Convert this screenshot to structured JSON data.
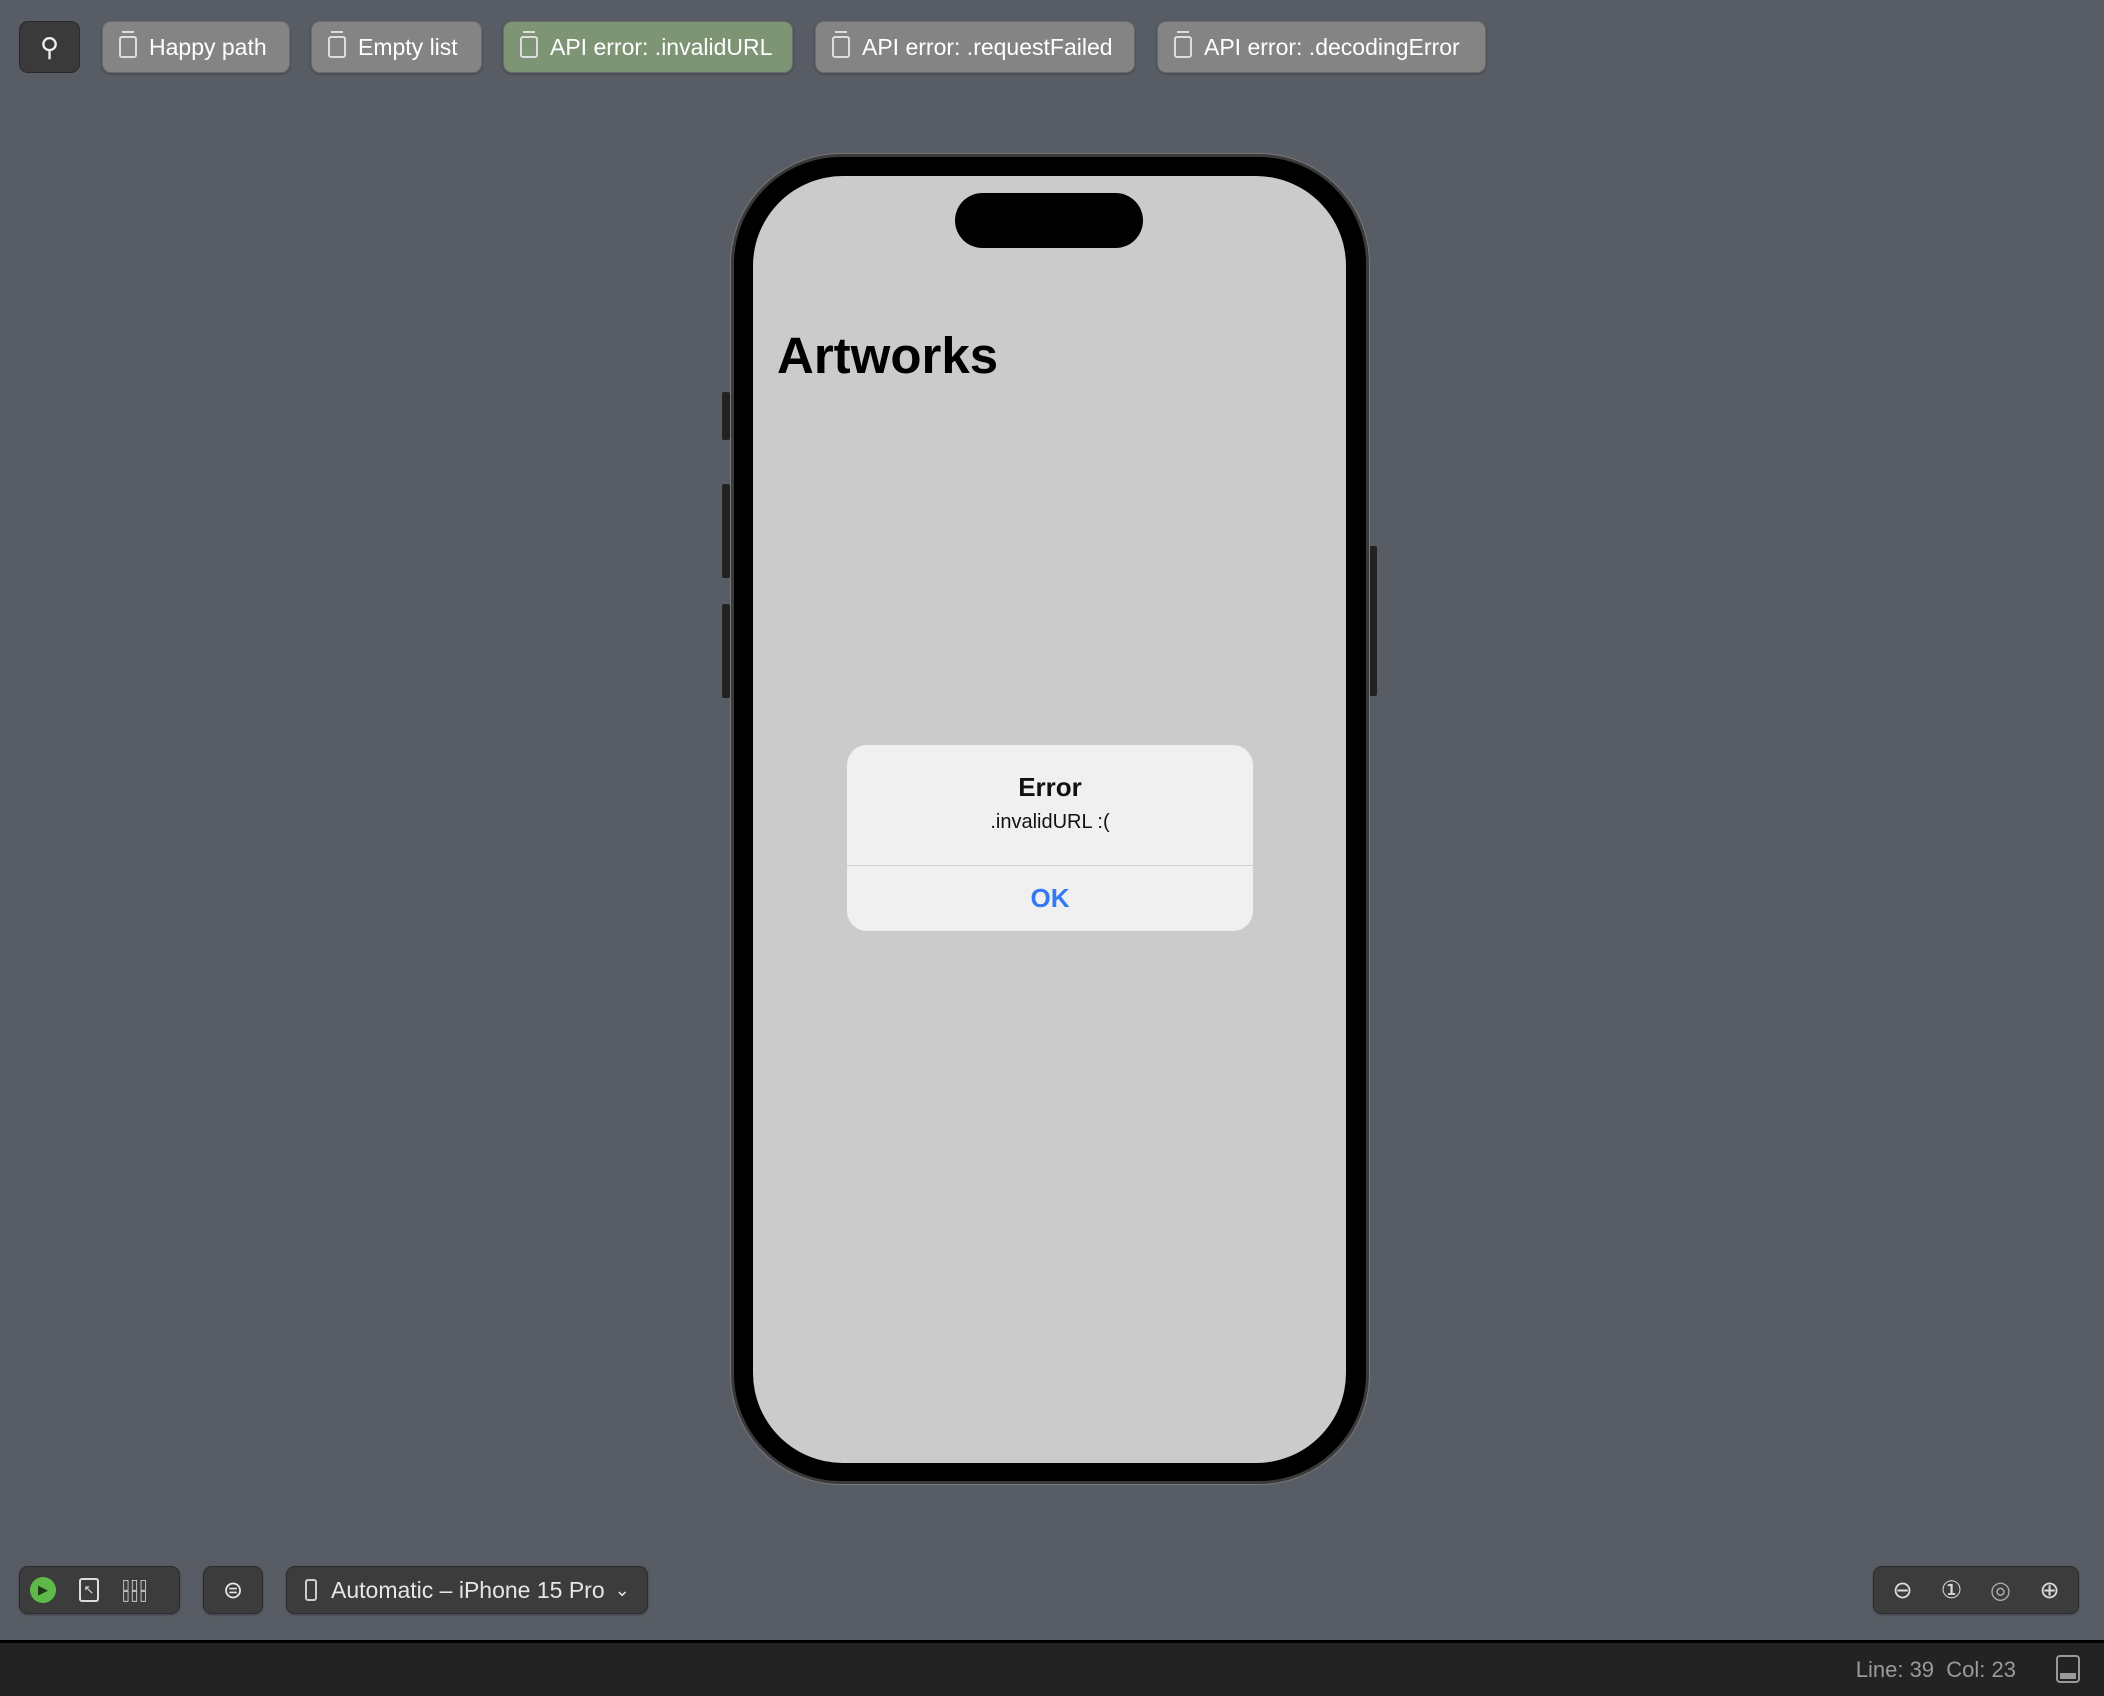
{
  "top_bar": {
    "pin_icon": "pin-icon",
    "previews": [
      {
        "label": "Happy path",
        "active": false
      },
      {
        "label": "Empty list",
        "active": false
      },
      {
        "label": "API error: .invalidURL",
        "active": true
      },
      {
        "label": "API error: .requestFailed",
        "active": false
      },
      {
        "label": "API error: .decodingError",
        "active": false
      }
    ],
    "active_color": "#7d9475"
  },
  "device": {
    "screen": {
      "nav_title": "Artworks",
      "alert": {
        "title": "Error",
        "message": ".invalidURL :(",
        "button": "OK",
        "button_color": "#3478f6"
      }
    }
  },
  "bottom_toolbar": {
    "device_selector": "Automatic – iPhone 15 Pro",
    "live_color": "#5fb84a"
  },
  "status_bar": {
    "line": "Line: 39",
    "col": "Col: 23"
  }
}
